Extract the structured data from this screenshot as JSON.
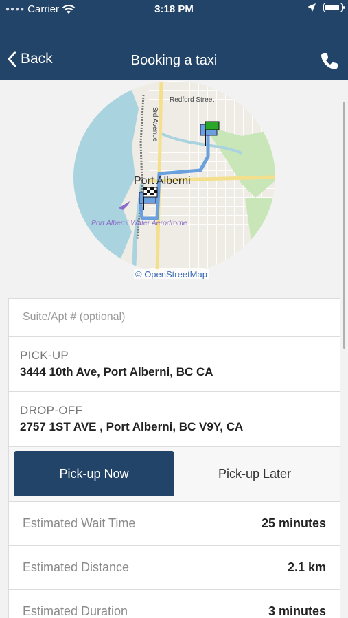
{
  "status_bar": {
    "carrier": "Carrier",
    "time": "3:18 PM"
  },
  "nav": {
    "back_label": "Back",
    "title": "Booking a taxi"
  },
  "map": {
    "labels": {
      "street1": "Redford Street",
      "street2": "3rd Avenue",
      "town": "Port Alberni",
      "aerodrome": "Port Alberni Water Aerodrome"
    },
    "attribution": "© OpenStreetMap",
    "colors": {
      "water": "#a9d3df",
      "park": "#c8e6b8",
      "route": "#6aa0de",
      "roads": "#ffffff",
      "major_road": "#f4e08c"
    }
  },
  "form": {
    "suite_placeholder": "Suite/Apt # (optional)",
    "pickup": {
      "label": "PICK-UP",
      "value": "3444 10th Ave, Port Alberni, BC CA"
    },
    "dropoff": {
      "label": "DROP-OFF",
      "value": "2757 1ST AVE , Port Alberni, BC V9Y, CA"
    },
    "toggle": {
      "now": "Pick-up Now",
      "later": "Pick-up Later",
      "selected": "now"
    },
    "info": [
      {
        "label": "Estimated Wait Time",
        "value": "25 minutes"
      },
      {
        "label": "Estimated Distance",
        "value": "2.1 km"
      },
      {
        "label": "Estimated Duration",
        "value": "3 minutes"
      }
    ]
  },
  "colors": {
    "brand": "#224468"
  }
}
